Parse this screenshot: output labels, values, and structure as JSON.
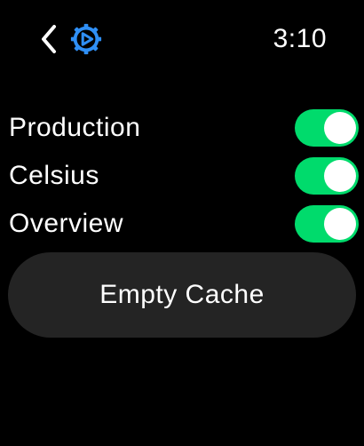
{
  "status_bar": {
    "time": "3:10",
    "back_icon": "chevron-left-icon",
    "app_icon": "gear-play-icon",
    "accent_color": "#2f8ff5"
  },
  "settings": {
    "items": [
      {
        "label": "Production",
        "enabled": true
      },
      {
        "label": "Celsius",
        "enabled": true
      },
      {
        "label": "Overview",
        "enabled": true
      }
    ],
    "toggle_on_color": "#00db6c"
  },
  "actions": {
    "empty_cache_label": "Empty Cache"
  }
}
